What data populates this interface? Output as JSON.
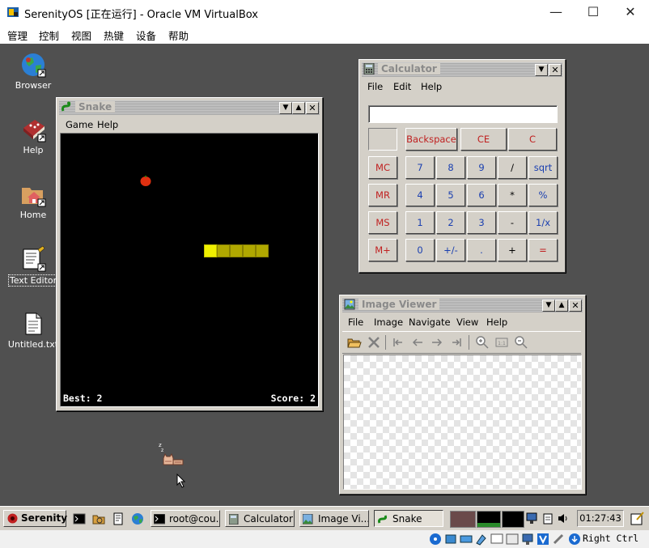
{
  "host": {
    "title": "SerenityOS [正在运行] - Oracle VM VirtualBox",
    "menu": [
      "管理",
      "控制",
      "视图",
      "热键",
      "设备",
      "帮助"
    ],
    "minimize": "—",
    "maximize": "☐",
    "close": "✕",
    "host_key": "Right Ctrl"
  },
  "desktop_icons": [
    {
      "label": "Browser",
      "icon": "globe-icon"
    },
    {
      "label": "Help",
      "icon": "book-icon"
    },
    {
      "label": "Home",
      "icon": "home-folder-icon"
    },
    {
      "label": "Text Editor",
      "icon": "text-editor-icon"
    },
    {
      "label": "Untitled.txt",
      "icon": "text-file-icon"
    }
  ],
  "snake": {
    "title": "Snake",
    "menu": [
      "Game",
      "Help"
    ],
    "best": "Best: 2",
    "score": "Score: 2"
  },
  "calculator": {
    "title": "Calculator",
    "menu": [
      "File",
      "Edit",
      "Help"
    ],
    "display": "",
    "top_buttons": [
      "Backspace",
      "CE",
      "C"
    ],
    "memory_buttons": [
      "MC",
      "MR",
      "MS",
      "M+"
    ],
    "rows": [
      [
        "7",
        "8",
        "9",
        "/",
        "sqrt"
      ],
      [
        "4",
        "5",
        "6",
        "*",
        "%"
      ],
      [
        "1",
        "2",
        "3",
        "-",
        "1/x"
      ],
      [
        "0",
        "+/-",
        ".",
        "+",
        "="
      ]
    ]
  },
  "image_viewer": {
    "title": "Image Viewer",
    "menu": [
      "File",
      "Image",
      "Navigate",
      "View",
      "Help"
    ]
  },
  "taskbar": {
    "start": "Serenity",
    "tasks": [
      "root@cou...",
      "Calculator",
      "Image Vi...",
      "Snake"
    ],
    "clock": "01:27:43"
  },
  "colors": {
    "desktop": "#505050",
    "apple": "#e03010",
    "snake_head": "#f0f000",
    "snake_body": "#b0a800"
  }
}
